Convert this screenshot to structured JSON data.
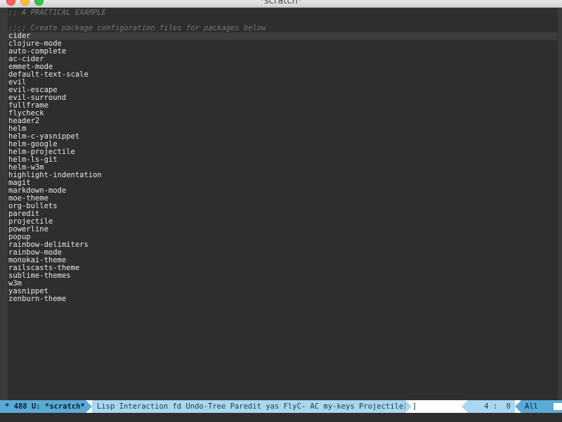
{
  "window": {
    "title": "*scratch*"
  },
  "buffer": {
    "lines": [
      {
        "text": ";; A PRACTICAL EXAMPLE",
        "kind": "comment"
      },
      {
        "text": "",
        "kind": "blank"
      },
      {
        "text": ";;;; Create package configuration files for packages below",
        "kind": "comment"
      },
      {
        "text": "cider",
        "kind": "current"
      },
      {
        "text": "clojure-mode",
        "kind": "text"
      },
      {
        "text": "auto-complete",
        "kind": "text"
      },
      {
        "text": "ac-cider",
        "kind": "text"
      },
      {
        "text": "emmet-mode",
        "kind": "text"
      },
      {
        "text": "default-text-scale",
        "kind": "text"
      },
      {
        "text": "evil",
        "kind": "text"
      },
      {
        "text": "evil-escape",
        "kind": "text"
      },
      {
        "text": "evil-surround",
        "kind": "text"
      },
      {
        "text": "fullframe",
        "kind": "text"
      },
      {
        "text": "flycheck",
        "kind": "text"
      },
      {
        "text": "header2",
        "kind": "text"
      },
      {
        "text": "helm",
        "kind": "text"
      },
      {
        "text": "helm-c-yasnippet",
        "kind": "text"
      },
      {
        "text": "helm-google",
        "kind": "text"
      },
      {
        "text": "helm-projectile",
        "kind": "text"
      },
      {
        "text": "helm-ls-git",
        "kind": "text"
      },
      {
        "text": "helm-w3m",
        "kind": "text"
      },
      {
        "text": "highlight-indentation",
        "kind": "text"
      },
      {
        "text": "magit",
        "kind": "text"
      },
      {
        "text": "markdown-mode",
        "kind": "text"
      },
      {
        "text": "moe-theme",
        "kind": "text"
      },
      {
        "text": "org-bullets",
        "kind": "text"
      },
      {
        "text": "paredit",
        "kind": "text"
      },
      {
        "text": "projectile",
        "kind": "text"
      },
      {
        "text": "powerline",
        "kind": "text"
      },
      {
        "text": "popup",
        "kind": "text"
      },
      {
        "text": "rainbow-delimiters",
        "kind": "text"
      },
      {
        "text": "rainbow-mode",
        "kind": "text"
      },
      {
        "text": "monokai-theme",
        "kind": "text"
      },
      {
        "text": "railscasts-theme",
        "kind": "text"
      },
      {
        "text": "sublime-themes",
        "kind": "text"
      },
      {
        "text": "w3m",
        "kind": "text"
      },
      {
        "text": "yasnippet",
        "kind": "text"
      },
      {
        "text": "zenburn-theme",
        "kind": "text"
      }
    ]
  },
  "modeline": {
    "status": "* 488 U: ",
    "buffer_name": "*scratch*",
    "modes": "Lisp Interaction fd Undo-Tree Paredit yas FlyC- AC my-keys Projectile[-]",
    "position": "4 :  0",
    "scroll": "All"
  },
  "colors": {
    "background": "#2e2e2e",
    "text": "#e8e8e8",
    "comment": "#757575",
    "modeline_dark": "#5aaad8",
    "modeline_light": "#a9d7f0"
  }
}
